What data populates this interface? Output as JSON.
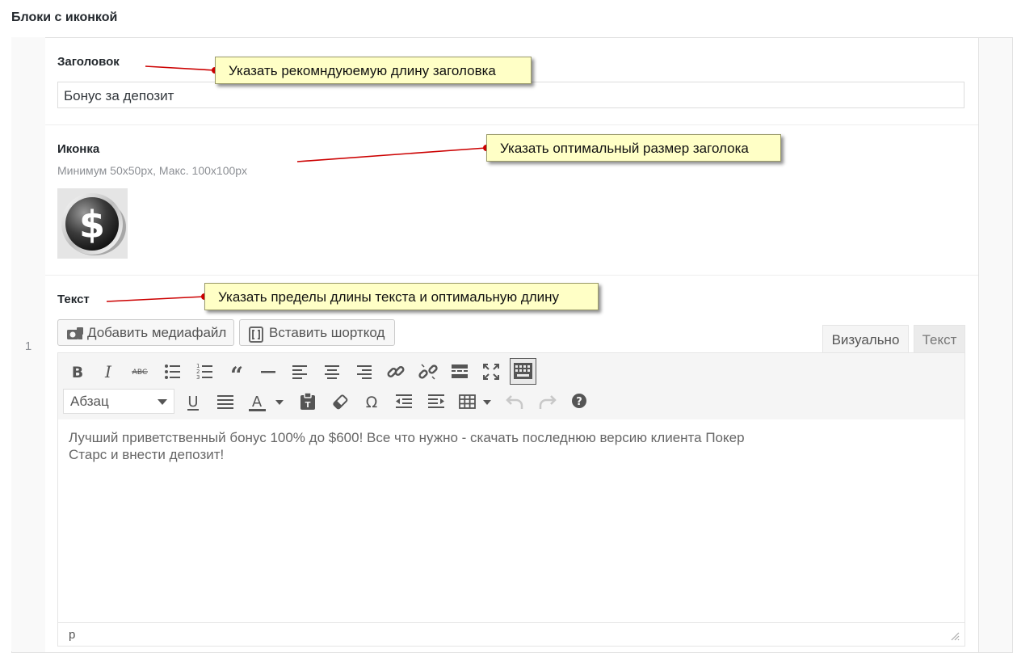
{
  "section": {
    "title": "Блоки с иконкой"
  },
  "row": {
    "number": "1"
  },
  "title_field": {
    "label": "Заголовок",
    "value": "Бонус за депозит"
  },
  "icon_field": {
    "label": "Иконка",
    "description": "Минимум 50x50px, Макс. 100x100px",
    "image": "dollar-coin-icon"
  },
  "text_field": {
    "label": "Текст",
    "buttons": {
      "add_media": "Добавить медиафайл",
      "insert_shortcode": "Вставить шорткод"
    },
    "tabs": {
      "visual": "Визуально",
      "text": "Текст"
    },
    "toolbar_row1": [
      "bold-icon",
      "italic-icon",
      "strikethrough-icon",
      "bullet-list-icon",
      "numbered-list-icon",
      "blockquote-icon",
      "horizontal-rule-icon",
      "align-left-icon",
      "align-center-icon",
      "align-right-icon",
      "link-icon",
      "unlink-icon",
      "read-more-icon",
      "fullscreen-icon",
      "toolbar-toggle-icon"
    ],
    "toolbar_row2": [
      "underline-icon",
      "justify-icon",
      "text-color-icon",
      "paste-text-icon",
      "clear-formatting-icon",
      "special-character-icon",
      "outdent-icon",
      "indent-icon",
      "table-icon",
      "undo-icon",
      "redo-icon",
      "help-icon"
    ],
    "format_select": "Абзац",
    "content_line1": "Лучший приветственный бонус 100% до $600! Все что нужно - скачать последнюю версию клиента Покер",
    "content_line2": "Старс и внести депозит!",
    "status_path": "p"
  },
  "annotations": {
    "title_note": "Указать рекомндуюемую длину заголовка",
    "icon_note": "Указать оптимальный размер заголока",
    "text_note": "Указать пределы длины текста и оптимальную длину"
  },
  "colors": {
    "callout_bg": "#ffffc6",
    "arrow": "#cc0000",
    "border": "#e1e1e1"
  }
}
